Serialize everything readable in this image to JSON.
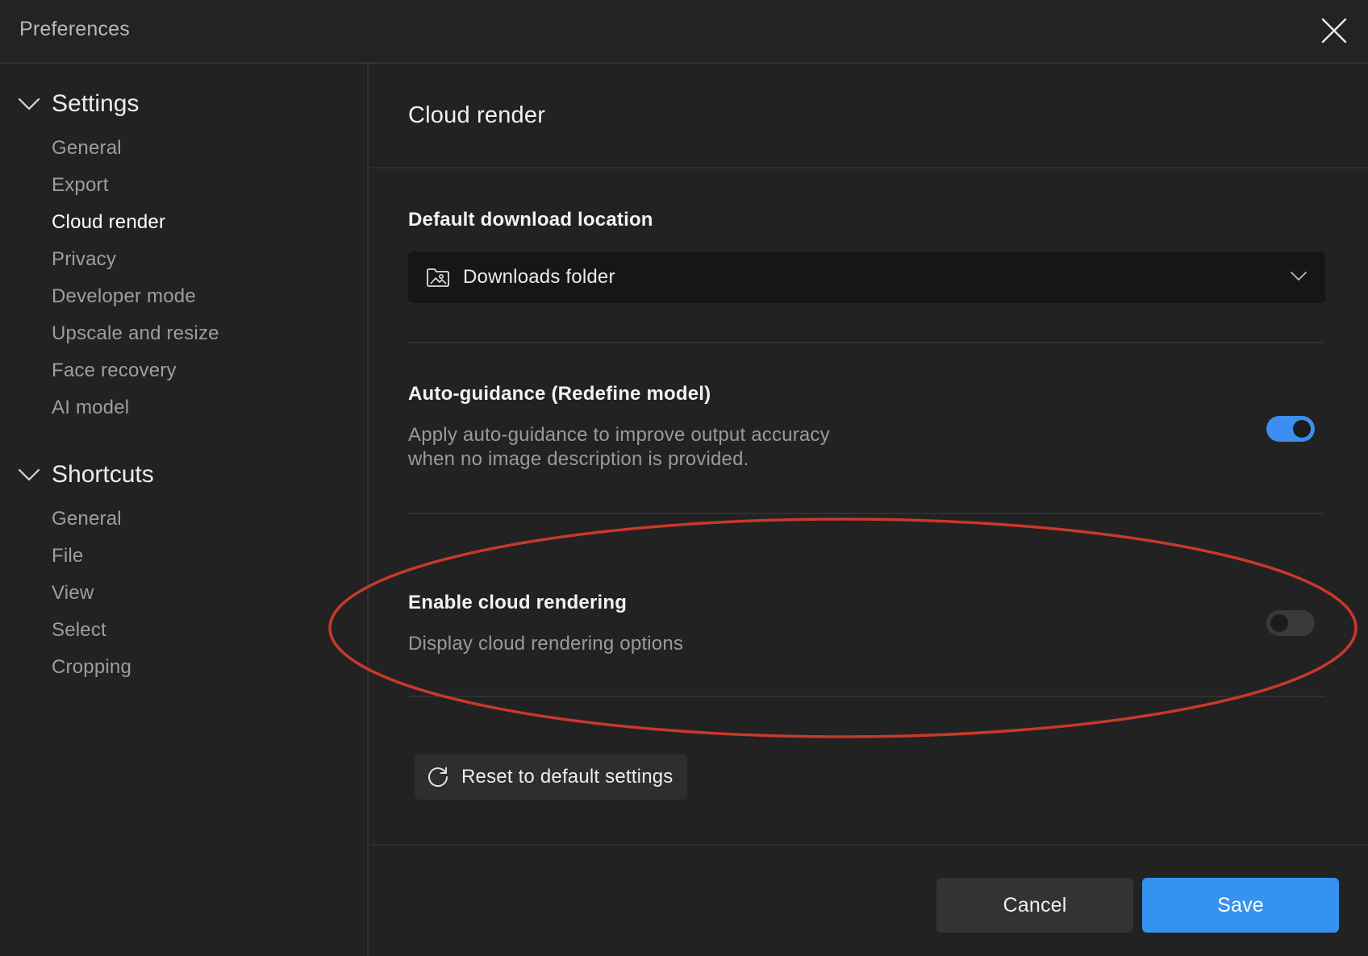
{
  "window": {
    "title": "Preferences"
  },
  "sidebar": {
    "groups": [
      {
        "label": "Settings",
        "items": [
          {
            "label": "General"
          },
          {
            "label": "Export"
          },
          {
            "label": "Cloud render",
            "active": true
          },
          {
            "label": "Privacy"
          },
          {
            "label": "Developer mode"
          },
          {
            "label": "Upscale and resize"
          },
          {
            "label": "Face recovery"
          },
          {
            "label": "AI model"
          }
        ]
      },
      {
        "label": "Shortcuts",
        "items": [
          {
            "label": "General"
          },
          {
            "label": "File"
          },
          {
            "label": "View"
          },
          {
            "label": "Select"
          },
          {
            "label": "Cropping"
          }
        ]
      }
    ]
  },
  "main": {
    "title": "Cloud render",
    "download_location": {
      "label": "Default download location",
      "selected": "Downloads folder"
    },
    "auto_guidance": {
      "label": "Auto-guidance (Redefine model)",
      "description_line1": "Apply auto-guidance to improve output accuracy",
      "description_line2": "when no image description is provided.",
      "enabled": true
    },
    "cloud_rendering": {
      "label": "Enable cloud rendering",
      "description": "Display cloud rendering options",
      "enabled": false
    },
    "reset_label": "Reset to default settings"
  },
  "footer": {
    "cancel_label": "Cancel",
    "save_label": "Save"
  },
  "colors": {
    "accent": "#3592ee",
    "toggle_on": "#3c8ef0",
    "toggle_off": "#3a3a3a",
    "annotation": "#c8392b"
  },
  "icons": {
    "close": "close-icon",
    "chevron": "chevron-down-icon",
    "folder": "folder-image-icon",
    "reset": "refresh-icon"
  }
}
